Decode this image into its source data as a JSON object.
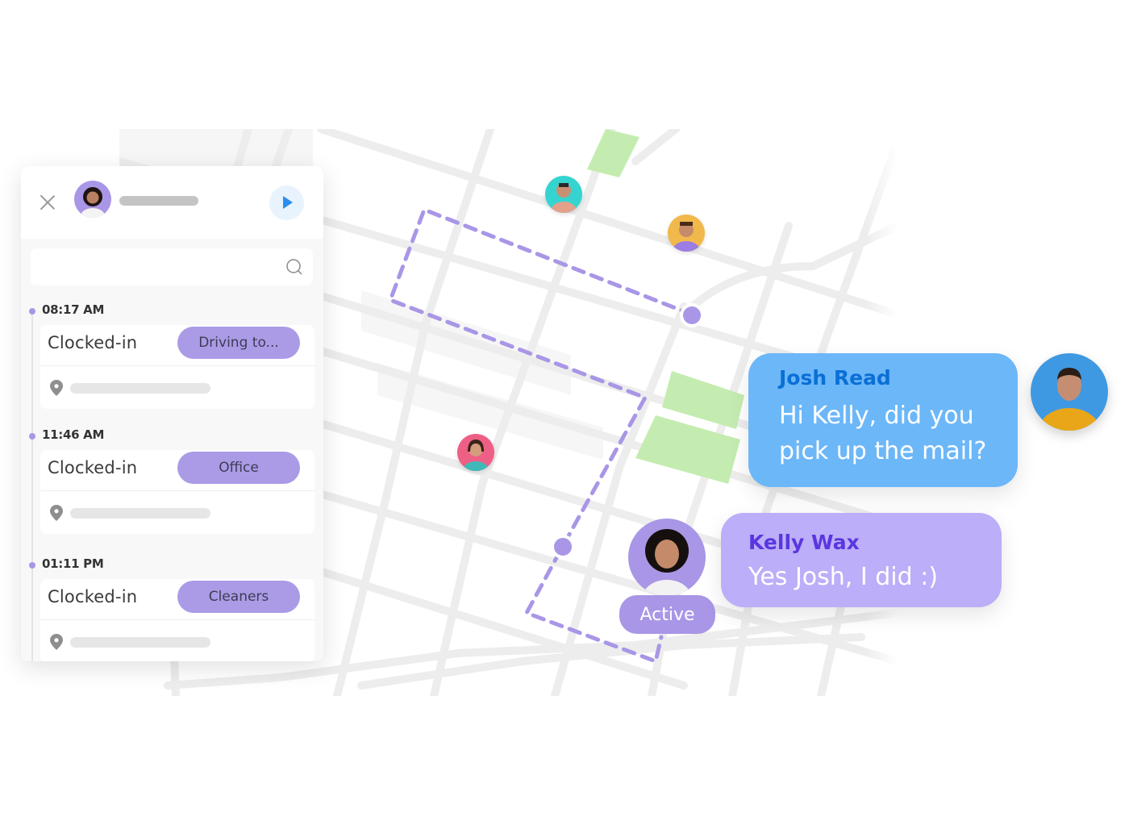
{
  "colors": {
    "accent_purple": "#a996e6",
    "chip_purple": "#ab9be6",
    "route_purple": "#a996e6",
    "josh_bubble": "#6cb7f8",
    "josh_name": "#0a6fd6",
    "kelly_bubble": "#bcaef8",
    "kelly_name": "#5a36e0",
    "park_green": "#c4ecb0",
    "play_blue": "#2b8ef0"
  },
  "panel": {
    "close_icon": "close-icon",
    "play_icon": "play-icon",
    "search": {
      "value": "",
      "placeholder": ""
    },
    "entries": [
      {
        "time": "08:17 AM",
        "status": "Clocked-in",
        "chip": "Driving to..."
      },
      {
        "time": "11:46 AM",
        "status": "Clocked-in",
        "chip": "Office"
      },
      {
        "time": "01:11 PM",
        "status": "Clocked-in",
        "chip": "Cleaners"
      }
    ]
  },
  "map": {
    "markers": [
      "route-waypoint",
      "route-waypoint"
    ],
    "avatars": [
      "team-member",
      "team-member",
      "team-member"
    ]
  },
  "kelly": {
    "badge": "Active"
  },
  "chat": {
    "josh": {
      "name": "Josh Read",
      "line1": "Hi Kelly, did you",
      "line2": "pick up the mail?"
    },
    "kelly": {
      "name": "Kelly Wax",
      "line1": "Yes Josh, I did :)"
    }
  }
}
